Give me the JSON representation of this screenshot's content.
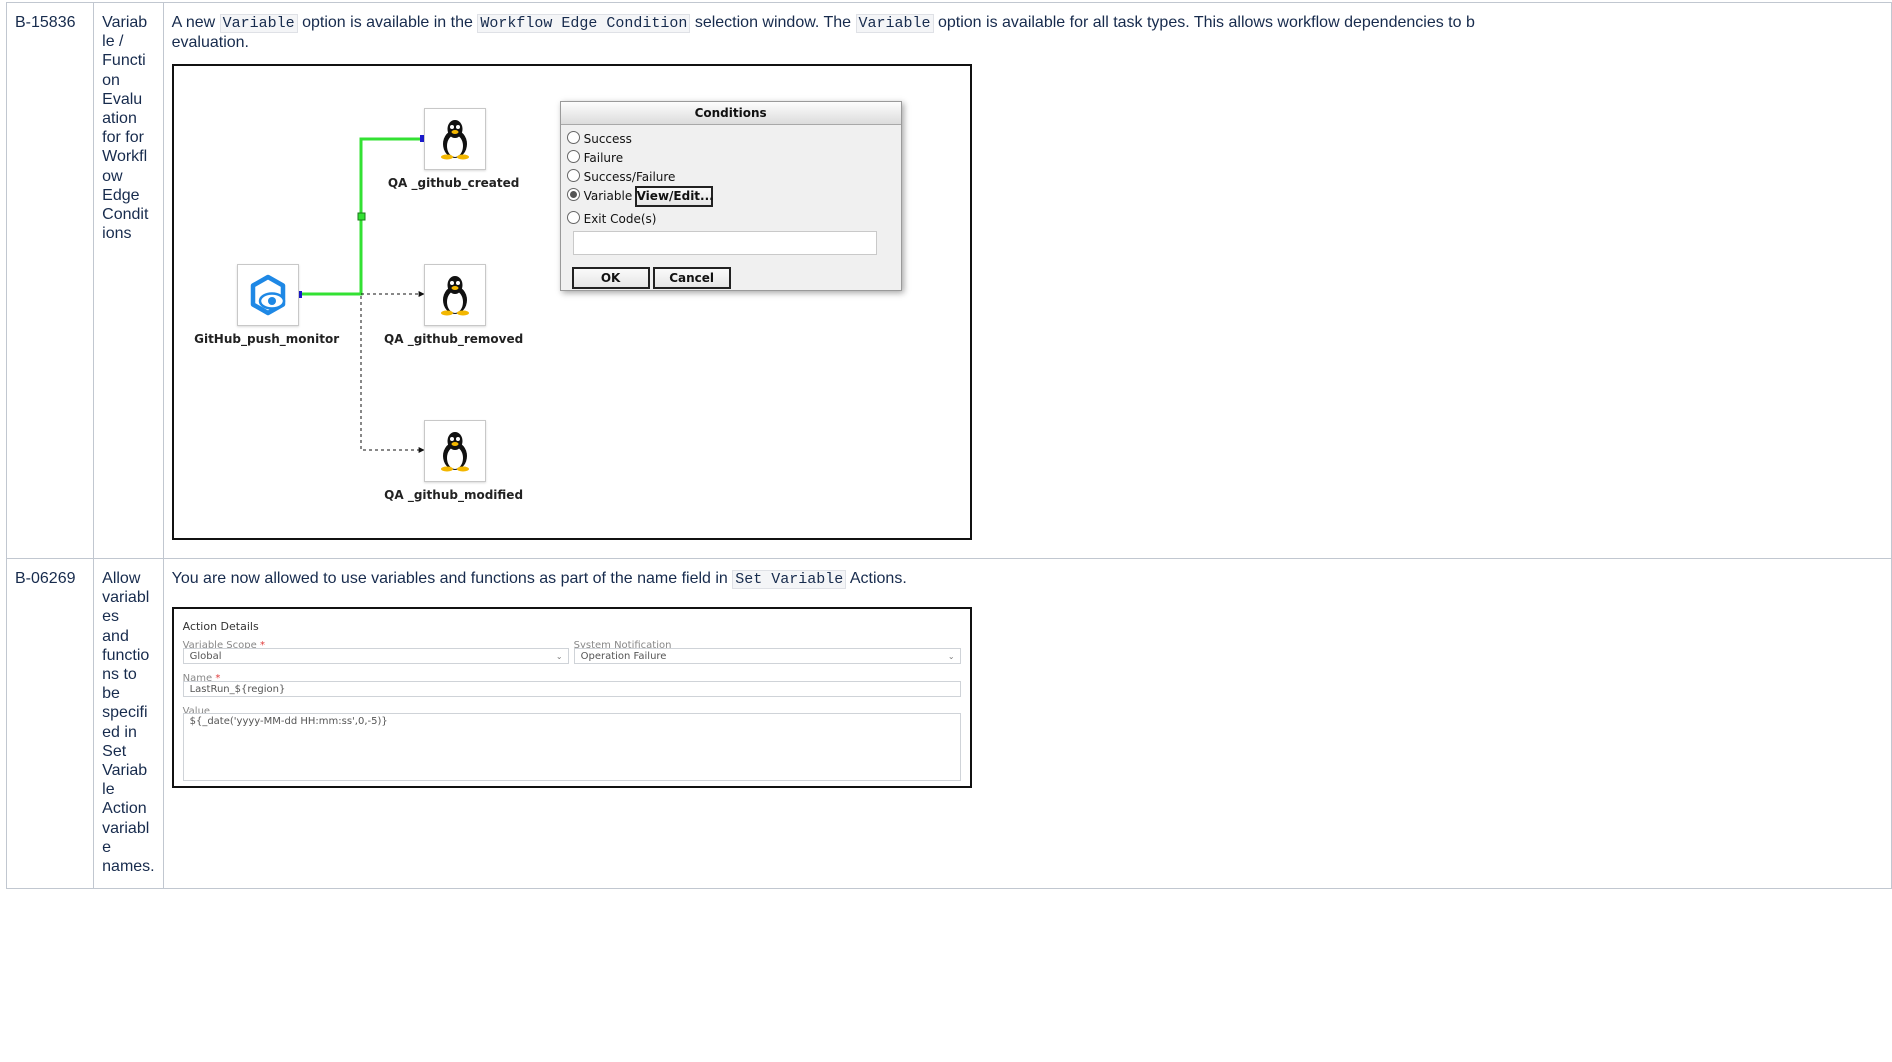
{
  "rows": [
    {
      "id": "B-15836",
      "title_lines": [
        "Variab",
        "le /",
        "Functi",
        "on",
        "Evalu",
        "ation",
        "for for",
        "Workfl",
        "ow",
        "Edge",
        "Condit",
        "ions"
      ],
      "desc_parts": [
        "A new ",
        "Variable",
        " option is available in the ",
        "Workflow Edge Condition",
        " selection window. The ",
        "Variable",
        " option is available for all task types. This allows workflow dependencies to b"
      ],
      "desc_line2": "evaluation.",
      "figure": {
        "nodes": {
          "monitor": "GitHub_push_monitor",
          "created": "QA _github_created",
          "removed": "QA _github_removed",
          "modified": "QA _github_modified"
        },
        "icons": {
          "monitor": "eye-hexagon-icon",
          "task": "linux-penguin-icon"
        },
        "colors": {
          "selected_edge": "#33e133",
          "handle": "#1a1acc"
        },
        "dialog": {
          "title": "Conditions",
          "options": [
            "Success",
            "Failure",
            "Success/Failure",
            "Variable",
            "Exit Code(s)"
          ],
          "selected": "Variable",
          "view_edit_label": "View/Edit...",
          "exit_codes_value": "",
          "ok_label": "OK",
          "cancel_label": "Cancel"
        }
      }
    },
    {
      "id": "B-06269",
      "title_lines": [
        "Allow",
        "variabl",
        "es",
        "and",
        "functio",
        "ns to",
        "be",
        "specifi",
        "ed in",
        "Set",
        "Variab",
        "le",
        "Action",
        "variabl",
        "e",
        "names."
      ],
      "desc_parts": [
        "You are now allowed to use variables and functions as part of the name field in ",
        "Set Variable",
        " Actions."
      ],
      "figure": {
        "heading": "Action Details",
        "variable_scope_label": "Variable Scope",
        "variable_scope_value": "Global",
        "system_notification_label": "System Notification",
        "system_notification_value": "Operation Failure",
        "name_label": "Name",
        "name_value": "LastRun_${region}",
        "value_label": "Value",
        "value_value": "${_date('yyyy-MM-dd HH:mm:ss',0,-5)}",
        "required_mark": "*"
      }
    }
  ]
}
